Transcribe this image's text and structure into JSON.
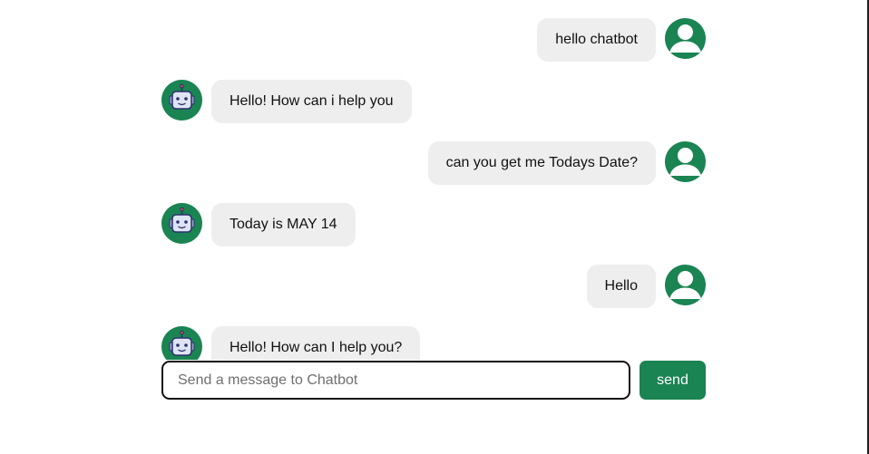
{
  "colors": {
    "accent": "#1a8452",
    "bubble_bg": "#eeeeee",
    "bot_face": "#dfe4f3",
    "bot_outline": "#2d2f6f"
  },
  "messages": [
    {
      "sender": "user",
      "text": "hello chatbot",
      "avatar_icon": "user-avatar-icon"
    },
    {
      "sender": "bot",
      "text": "Hello! How can i help you",
      "avatar_icon": "robot-avatar-icon"
    },
    {
      "sender": "user",
      "text": "can you get me Todays Date?",
      "avatar_icon": "user-avatar-icon"
    },
    {
      "sender": "bot",
      "text": "Today is MAY 14",
      "avatar_icon": "robot-avatar-icon"
    },
    {
      "sender": "user",
      "text": "Hello",
      "avatar_icon": "user-avatar-icon"
    },
    {
      "sender": "bot",
      "text": "Hello! How can I help you?",
      "avatar_icon": "robot-avatar-icon"
    }
  ],
  "composer": {
    "placeholder": "Send a message to Chatbot",
    "value": "",
    "send_label": "send"
  }
}
